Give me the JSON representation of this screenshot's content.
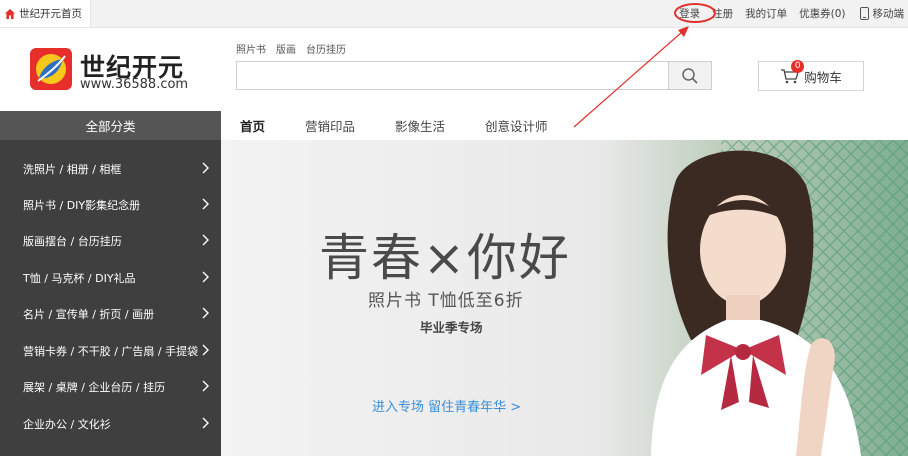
{
  "topbar": {
    "home_tab": "世纪开元首页",
    "login": "登录",
    "register": "注册",
    "orders": "我的订单",
    "coupons": "优惠券(0)",
    "mobile": "移动端"
  },
  "logo": {
    "title": "世纪开元",
    "url": "www.36588.com"
  },
  "search": {
    "quicklinks": [
      "照片书",
      "版画",
      "台历挂历"
    ],
    "placeholder": ""
  },
  "cart": {
    "label": "购物车",
    "count": "0"
  },
  "nav": {
    "all_categories": "全部分类",
    "items": [
      "首页",
      "营销印品",
      "影像生活",
      "创意设计师"
    ]
  },
  "categories": [
    "洗照片 / 相册 / 相框",
    "照片书 / DIY影集纪念册",
    "版画摆台 / 台历挂历",
    "T恤 / 马克杯 / DIY礼品",
    "名片 / 宣传单 / 折页 / 画册",
    "营销卡券 / 不干胶 / 广告扇 / 手提袋",
    "展架 / 桌牌 / 企业台历 / 挂历",
    "企业办公 / 文化衫"
  ],
  "banner": {
    "headline": "青春×你好",
    "subhead": "照片书 T恤低至6折",
    "sub2": "毕业季专场",
    "cta": "进入专场 留住青春年华 >"
  },
  "colors": {
    "brand_red": "#e62f2a",
    "sidebar_bg": "#3f3f3f",
    "annotation_red": "#e0322d",
    "link_blue": "#3a8fd8"
  }
}
